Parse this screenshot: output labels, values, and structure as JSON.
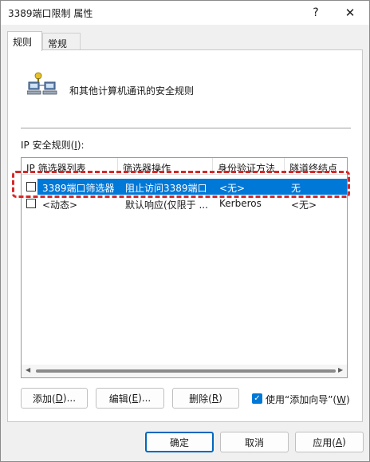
{
  "window": {
    "title": "3389端口限制 属性",
    "help_glyph": "?",
    "close_glyph": "✕"
  },
  "tabs": [
    {
      "label": "规则",
      "active": true
    },
    {
      "label": "常规",
      "active": false
    }
  ],
  "panel": {
    "icon": "network-computers-icon",
    "description": "和其他计算机通讯的安全规则",
    "rules_label_pre": "IP 安全规则(",
    "rules_label_key": "I",
    "rules_label_post": "):"
  },
  "table": {
    "columns": [
      "IP 筛选器列表",
      "筛选器操作",
      "身份验证方法",
      "隧道终结点"
    ],
    "rows": [
      {
        "checked": false,
        "selected": true,
        "cells": [
          "3389端口筛选器",
          "阻止访问3389端口",
          "<无>",
          "无"
        ]
      },
      {
        "checked": false,
        "selected": false,
        "cells": [
          "<动态>",
          "默认响应(仅限于 ...",
          "Kerberos",
          "<无>"
        ]
      }
    ]
  },
  "buttons": {
    "add_pre": "添加(",
    "add_key": "D",
    "add_post": ")...",
    "edit_pre": "编辑(",
    "edit_key": "E",
    "edit_post": ")...",
    "remove_pre": "删除(",
    "remove_key": "R",
    "remove_post": ")",
    "wizard_pre": "使用“添加向导”(",
    "wizard_key": "W",
    "wizard_post": ")",
    "wizard_checked": true,
    "ok": "确定",
    "cancel": "取消",
    "apply_pre": "应用(",
    "apply_key": "A",
    "apply_post": ")"
  },
  "colors": {
    "selection": "#0078d7",
    "highlight_annotation": "#d62828"
  }
}
